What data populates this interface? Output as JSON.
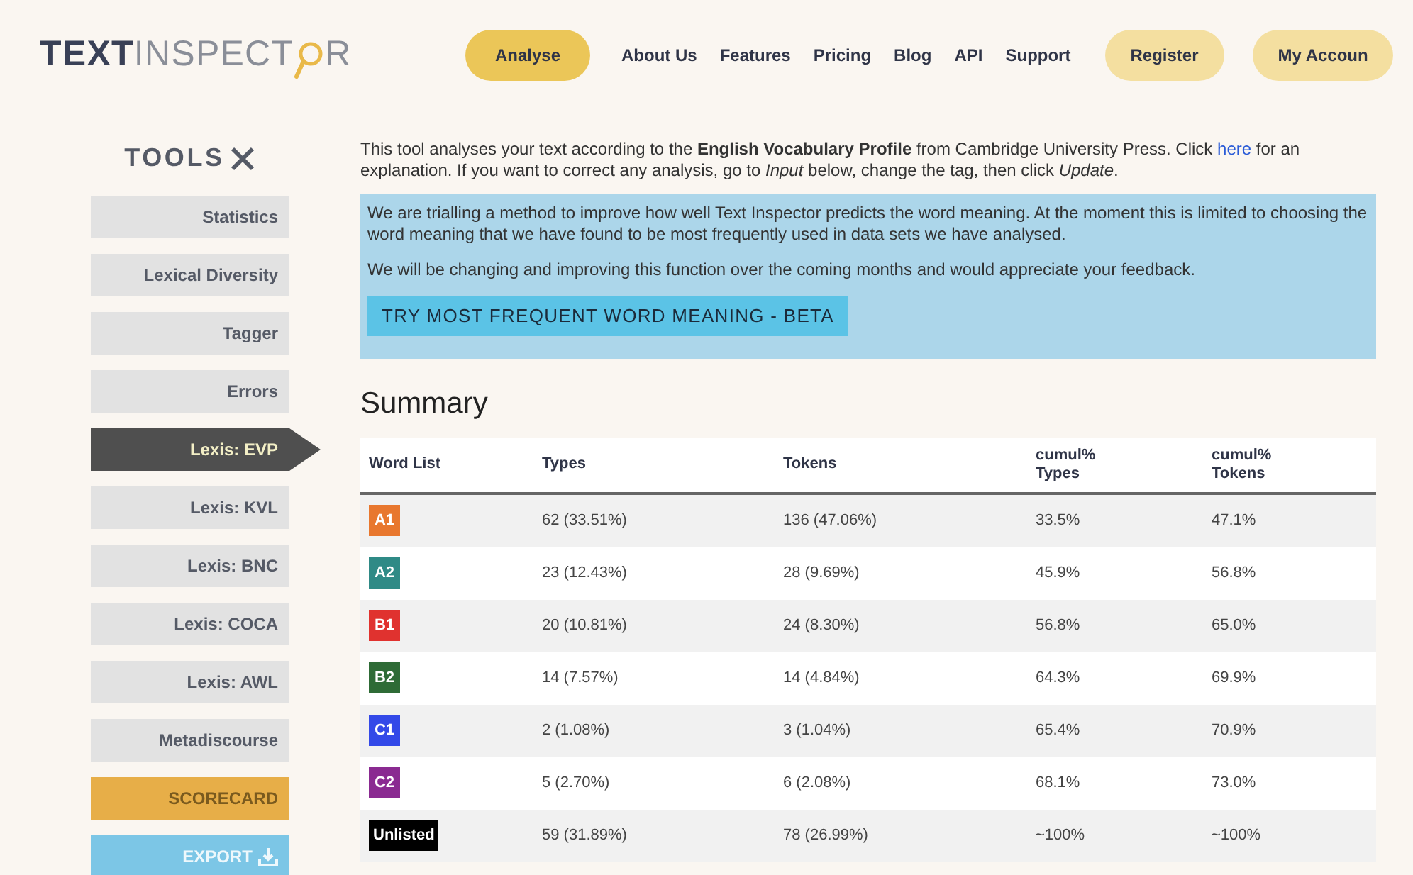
{
  "logo": {
    "bold_part": "TEXT",
    "light_part": "INSPECT",
    "tail": "R"
  },
  "nav": [
    {
      "label": "Analyse",
      "kind": "primary"
    },
    {
      "label": "About Us",
      "kind": "link"
    },
    {
      "label": "Features",
      "kind": "link"
    },
    {
      "label": "Pricing",
      "kind": "link"
    },
    {
      "label": "Blog",
      "kind": "link"
    },
    {
      "label": "API",
      "kind": "link"
    },
    {
      "label": "Support",
      "kind": "link"
    },
    {
      "label": "Register",
      "kind": "secondary"
    },
    {
      "label": "My Accoun",
      "kind": "secondary"
    }
  ],
  "sidebar": {
    "title": "TOOLS",
    "items": [
      {
        "label": "Statistics",
        "kind": "tool",
        "selected": false
      },
      {
        "label": "Lexical Diversity",
        "kind": "tool",
        "selected": false
      },
      {
        "label": "Tagger",
        "kind": "tool",
        "selected": false
      },
      {
        "label": "Errors",
        "kind": "tool",
        "selected": false
      },
      {
        "label": "Lexis: EVP",
        "kind": "tool",
        "selected": true
      },
      {
        "label": "Lexis: KVL",
        "kind": "tool",
        "selected": false
      },
      {
        "label": "Lexis: BNC",
        "kind": "tool",
        "selected": false
      },
      {
        "label": "Lexis: COCA",
        "kind": "tool",
        "selected": false
      },
      {
        "label": "Lexis: AWL",
        "kind": "tool",
        "selected": false
      },
      {
        "label": "Metadiscourse",
        "kind": "tool",
        "selected": false
      },
      {
        "label": "SCORECARD",
        "kind": "scorecard",
        "selected": false
      },
      {
        "label": "EXPORT",
        "kind": "export",
        "selected": false
      }
    ]
  },
  "intro": {
    "text": "This tool analyses your text according to the **English Vocabulary Profile** from Cambridge University Press. Click",
    "link": "here",
    "text_after": "for an explanation. If you want to correct any analysis, go to *Input* below, change the tag, then click *Update*."
  },
  "notice": {
    "paragraphs": [
      "We are trialling a method to improve how well Text Inspector predicts the word meaning. At the moment this is limited to choosing the word meaning that we have found to be most frequently used in data sets we have analysed.",
      "We will be changing and improving this function over the coming months and would appreciate your feedback."
    ],
    "button": "TRY MOST FREQUENT WORD MEANING - BETA"
  },
  "summary": {
    "title": "Summary",
    "columns": [
      "Word List",
      "Types",
      "Tokens",
      "cumul%\nTypes",
      "cumul%\nTokens"
    ],
    "rows": [
      {
        "level": "A1",
        "color": "#e8772e",
        "types": "62 (33.51%)",
        "tokens": "136 (47.06%)",
        "cumul_types": "33.5%",
        "cumul_tokens": "47.1%"
      },
      {
        "level": "A2",
        "color": "#2f8a86",
        "types": "23 (12.43%)",
        "tokens": "28 (9.69%)",
        "cumul_types": "45.9%",
        "cumul_tokens": "56.8%"
      },
      {
        "level": "B1",
        "color": "#e0322f",
        "types": "20 (10.81%)",
        "tokens": "24 (8.30%)",
        "cumul_types": "56.8%",
        "cumul_tokens": "65.0%"
      },
      {
        "level": "B2",
        "color": "#2e6b36",
        "types": "14 (7.57%)",
        "tokens": "14 (4.84%)",
        "cumul_types": "64.3%",
        "cumul_tokens": "69.9%"
      },
      {
        "level": "C1",
        "color": "#3349e8",
        "types": "2 (1.08%)",
        "tokens": "3 (1.04%)",
        "cumul_types": "65.4%",
        "cumul_tokens": "70.9%"
      },
      {
        "level": "C2",
        "color": "#8a2a91",
        "types": "5 (2.70%)",
        "tokens": "6 (2.08%)",
        "cumul_types": "68.1%",
        "cumul_tokens": "73.0%"
      },
      {
        "level": "Unlisted",
        "color": "#000000",
        "types": "59 (31.89%)",
        "tokens": "78 (26.99%)",
        "cumul_types": "~100%",
        "cumul_tokens": "~100%"
      }
    ]
  }
}
